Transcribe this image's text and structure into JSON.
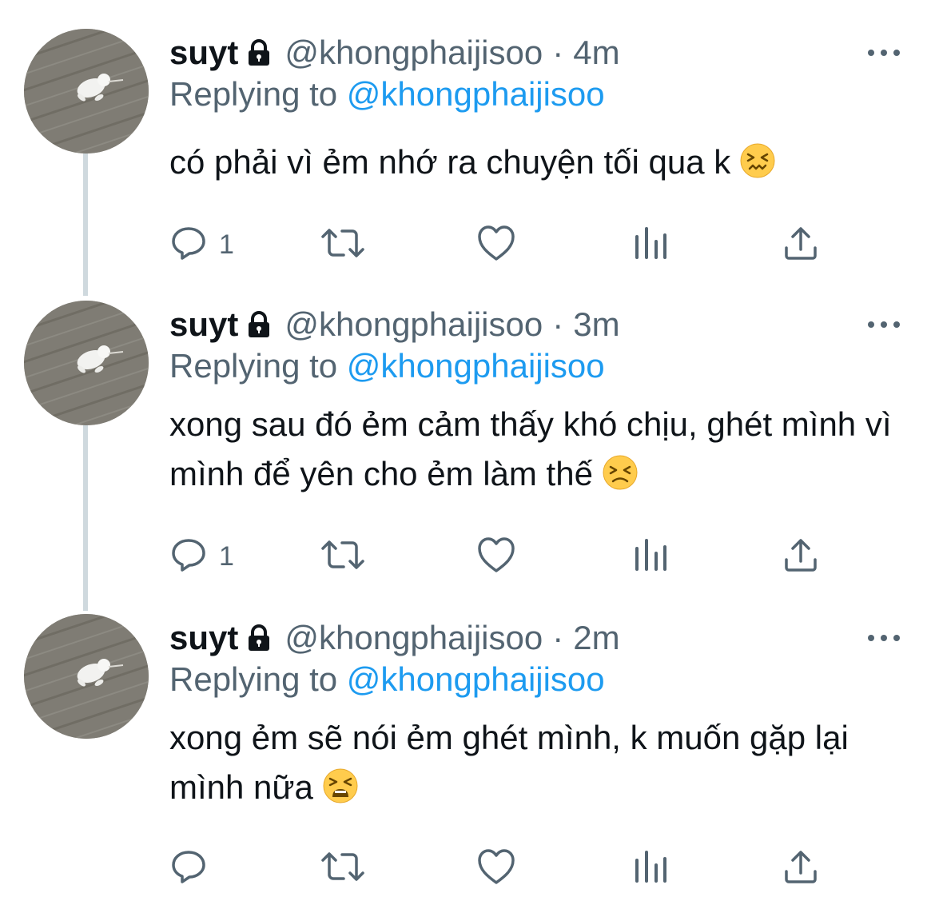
{
  "colors": {
    "text_primary": "#0f1419",
    "text_secondary": "#536471",
    "link": "#1d9bf0",
    "thread_line": "#cfd9de"
  },
  "icons": [
    "lock-icon",
    "more-icon",
    "reply-icon",
    "retweet-icon",
    "like-icon",
    "views-icon",
    "share-icon",
    "emoji-confounded",
    "emoji-persevering",
    "emoji-weary"
  ],
  "tweets": [
    {
      "name": "suyt",
      "handle": "@khongphaijisoo",
      "separator": "·",
      "time": "4m",
      "replying_label": "Replying to",
      "replying_to": "@khongphaijisoo",
      "text": "có phải vì ẻm nhớ ra chuyện tối qua k",
      "emoji": "emoji-confounded",
      "reply_count": "1"
    },
    {
      "name": "suyt",
      "handle": "@khongphaijisoo",
      "separator": "·",
      "time": "3m",
      "replying_label": "Replying to",
      "replying_to": "@khongphaijisoo",
      "text": "xong sau đó ẻm cảm thấy khó chịu, ghét mình vì mình để yên cho ẻm làm thế",
      "emoji": "emoji-persevering",
      "reply_count": "1"
    },
    {
      "name": "suyt",
      "handle": "@khongphaijisoo",
      "separator": "·",
      "time": "2m",
      "replying_label": "Replying to",
      "replying_to": "@khongphaijisoo",
      "text": "xong ẻm sẽ nói ẻm ghét mình, k muốn gặp lại mình nữa",
      "emoji": "emoji-weary",
      "reply_count": ""
    }
  ]
}
